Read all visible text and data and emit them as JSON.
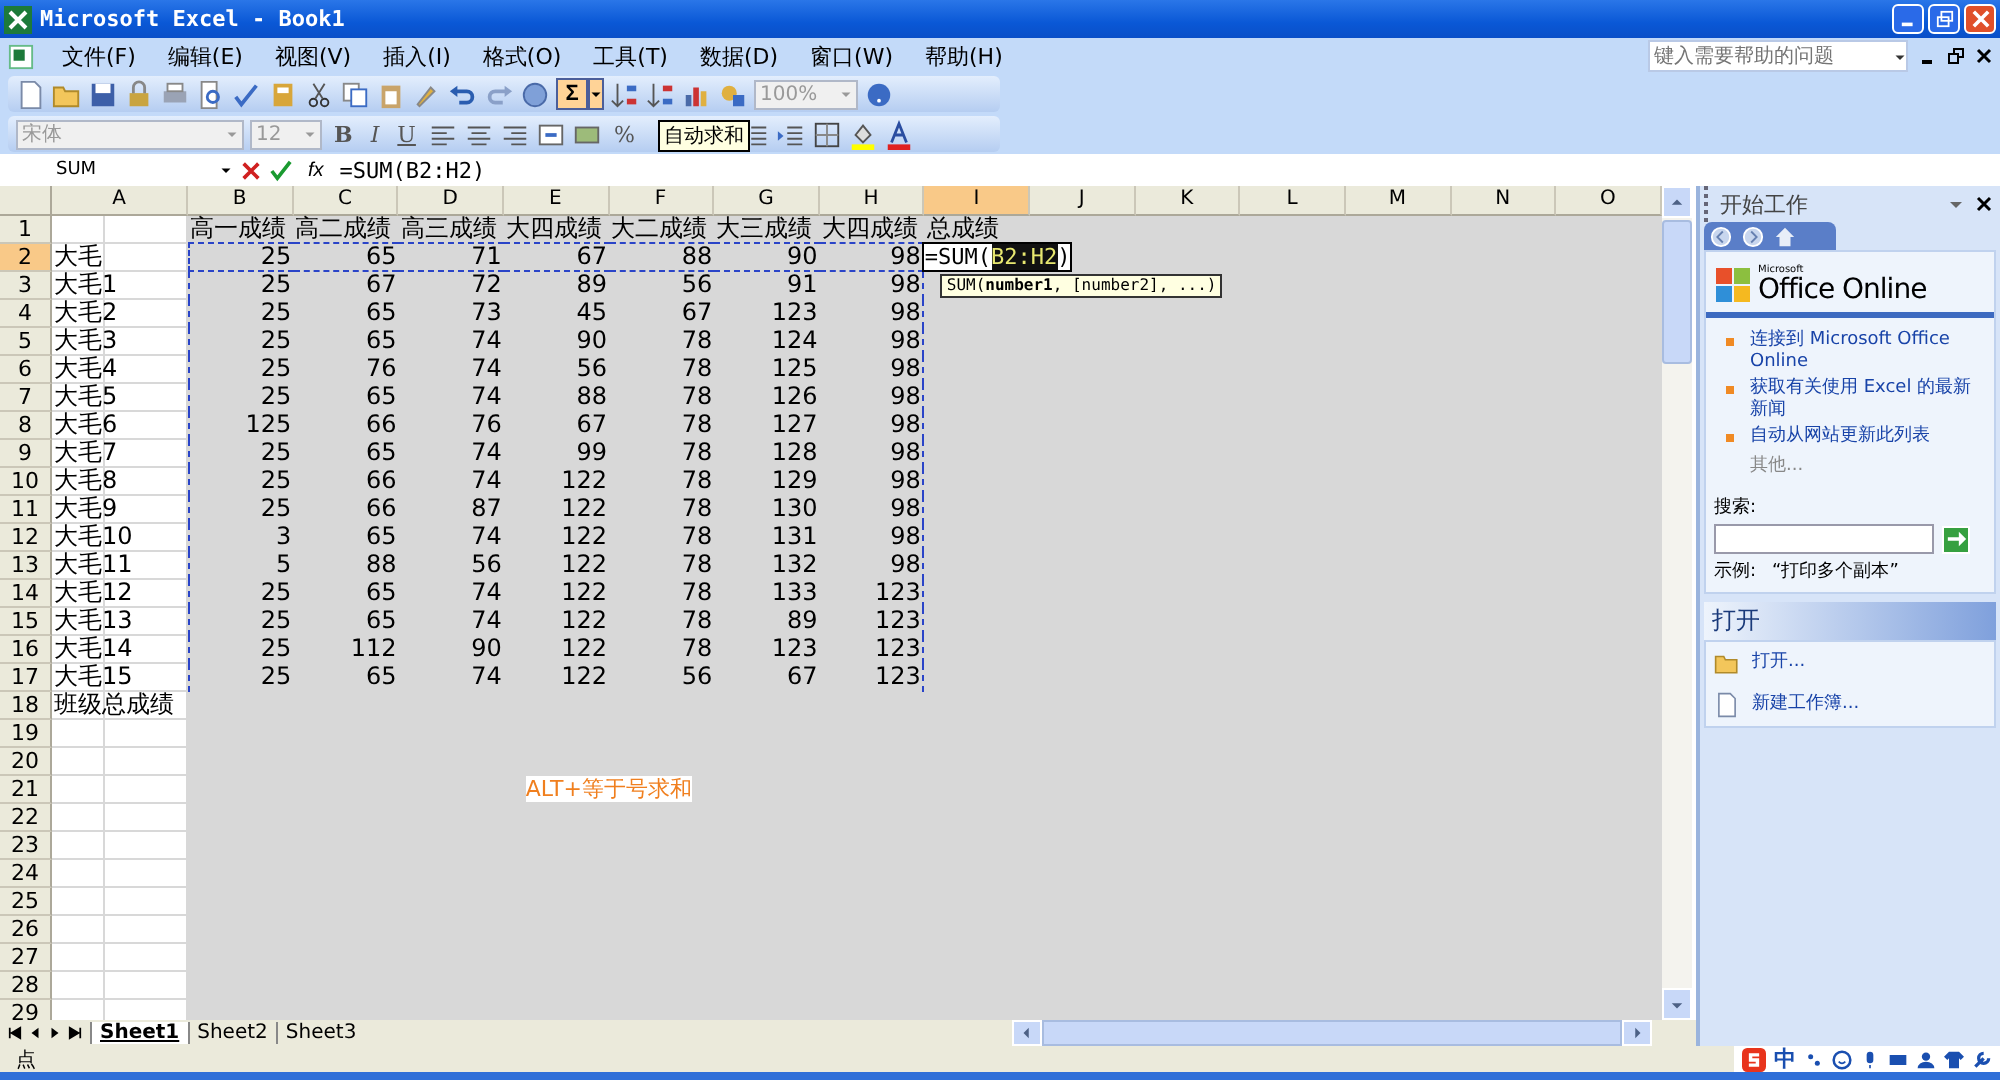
{
  "window": {
    "title": "Microsoft Excel - Book1"
  },
  "menu": [
    "文件(F)",
    "编辑(E)",
    "视图(V)",
    "插入(I)",
    "格式(O)",
    "工具(T)",
    "数据(D)",
    "窗口(W)",
    "帮助(H)"
  ],
  "help_search": {
    "placeholder": "键入需要帮助的问题"
  },
  "toolbar": {
    "autosum": "Σ",
    "zoom": "100%",
    "font": "宋体",
    "font_size": "12",
    "bold": "B",
    "italic": "I",
    "underline": "U",
    "percent": "%",
    "tooltip": "自动求和"
  },
  "formula_bar": {
    "name_box": "SUM",
    "fx": "fx",
    "formula": "=SUM(B2:H2)"
  },
  "columns": [
    {
      "label": "A",
      "selected": false
    },
    {
      "label": "B",
      "selected": false
    },
    {
      "label": "C",
      "selected": false
    },
    {
      "label": "D",
      "selected": false
    },
    {
      "label": "E",
      "selected": false
    },
    {
      "label": "F",
      "selected": false
    },
    {
      "label": "G",
      "selected": false
    },
    {
      "label": "H",
      "selected": false
    },
    {
      "label": "I",
      "selected": true
    },
    {
      "label": "J",
      "selected": false
    },
    {
      "label": "K",
      "selected": false
    },
    {
      "label": "L",
      "selected": false
    },
    {
      "label": "M",
      "selected": false
    },
    {
      "label": "N",
      "selected": false
    },
    {
      "label": "O",
      "selected": false
    }
  ],
  "rows": [
    {
      "number": "1",
      "selected": false,
      "kind": "header",
      "values": [
        "高一成绩",
        "高二成绩",
        "高三成绩",
        "大四成绩",
        "大二成绩",
        "大三成绩",
        "大四成绩",
        "总成绩"
      ]
    },
    {
      "number": "2",
      "selected": true,
      "label": "大毛",
      "values": [
        "25",
        "65",
        "71",
        "67",
        "88",
        "90",
        "98"
      ],
      "in_range": true,
      "editing": {
        "prefix": "=SUM(",
        "range": "B2:H2",
        "suffix": ")",
        "hint": "SUM(**number1**, [number2], ...)"
      }
    },
    {
      "number": "3",
      "selected": false,
      "label": "大毛1",
      "values": [
        "25",
        "67",
        "72",
        "89",
        "56",
        "91",
        "98"
      ]
    },
    {
      "number": "4",
      "selected": false,
      "label": "大毛2",
      "values": [
        "25",
        "65",
        "73",
        "45",
        "67",
        "123",
        "98"
      ]
    },
    {
      "number": "5",
      "selected": false,
      "label": "大毛3",
      "values": [
        "25",
        "65",
        "74",
        "90",
        "78",
        "124",
        "98"
      ]
    },
    {
      "number": "6",
      "selected": false,
      "label": "大毛4",
      "values": [
        "25",
        "76",
        "74",
        "56",
        "78",
        "125",
        "98"
      ]
    },
    {
      "number": "7",
      "selected": false,
      "label": "大毛5",
      "values": [
        "25",
        "65",
        "74",
        "88",
        "78",
        "126",
        "98"
      ]
    },
    {
      "number": "8",
      "selected": false,
      "label": "大毛6",
      "values": [
        "125",
        "66",
        "76",
        "67",
        "78",
        "127",
        "98"
      ]
    },
    {
      "number": "9",
      "selected": false,
      "label": "大毛7",
      "values": [
        "25",
        "65",
        "74",
        "99",
        "78",
        "128",
        "98"
      ]
    },
    {
      "number": "10",
      "selected": false,
      "label": "大毛8",
      "values": [
        "25",
        "66",
        "74",
        "122",
        "78",
        "129",
        "98"
      ]
    },
    {
      "number": "11",
      "selected": false,
      "label": "大毛9",
      "values": [
        "25",
        "66",
        "87",
        "122",
        "78",
        "130",
        "98"
      ]
    },
    {
      "number": "12",
      "selected": false,
      "label": "大毛10",
      "values": [
        "3",
        "65",
        "74",
        "122",
        "78",
        "131",
        "98"
      ]
    },
    {
      "number": "13",
      "selected": false,
      "label": "大毛11",
      "values": [
        "5",
        "88",
        "56",
        "122",
        "78",
        "132",
        "98"
      ]
    },
    {
      "number": "14",
      "selected": false,
      "label": "大毛12",
      "values": [
        "25",
        "65",
        "74",
        "122",
        "78",
        "133",
        "123"
      ]
    },
    {
      "number": "15",
      "selected": false,
      "label": "大毛13",
      "values": [
        "25",
        "65",
        "74",
        "122",
        "78",
        "89",
        "123"
      ]
    },
    {
      "number": "16",
      "selected": false,
      "label": "大毛14",
      "values": [
        "25",
        "112",
        "90",
        "122",
        "78",
        "123",
        "123"
      ]
    },
    {
      "number": "17",
      "selected": false,
      "label": "大毛15",
      "values": [
        "25",
        "65",
        "74",
        "122",
        "56",
        "67",
        "123"
      ]
    },
    {
      "number": "18",
      "selected": false,
      "label": "班级总成绩"
    },
    {
      "number": "19",
      "selected": false
    },
    {
      "number": "20",
      "selected": false
    },
    {
      "number": "21",
      "selected": false,
      "note": {
        "text": "ALT+等于号求和",
        "color": "#f07f1e"
      }
    },
    {
      "number": "22",
      "selected": false
    },
    {
      "number": "23",
      "selected": false
    },
    {
      "number": "24",
      "selected": false
    },
    {
      "number": "25",
      "selected": false
    },
    {
      "number": "26",
      "selected": false
    },
    {
      "number": "27",
      "selected": false
    },
    {
      "number": "28",
      "selected": false
    },
    {
      "number": "29",
      "selected": false
    }
  ],
  "sheet_tabs": [
    {
      "label": "Sheet1",
      "selected": true
    },
    {
      "label": "Sheet2",
      "selected": false
    },
    {
      "label": "Sheet3",
      "selected": false
    }
  ],
  "status_bar": {
    "mode": "点"
  },
  "ime": {
    "label": "中"
  },
  "task_pane": {
    "title": "开始工作",
    "logo_small": "Microsoft",
    "logo": "Office Online",
    "links": [
      "连接到 Microsoft Office Online",
      "获取有关使用 Excel 的最新新闻",
      "自动从网站更新此列表"
    ],
    "more": "其他...",
    "search_label": "搜索:",
    "example_label": "示例:",
    "example": "“打印多个副本”",
    "open_section": "打开",
    "open_items": [
      {
        "kind": "open",
        "label": "打开..."
      },
      {
        "kind": "new",
        "label": "新建工作簿..."
      }
    ]
  }
}
